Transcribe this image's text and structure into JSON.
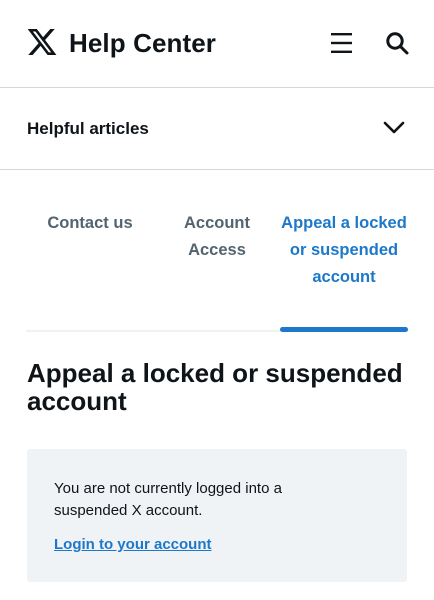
{
  "header": {
    "title": "Help Center",
    "logo_icon": "x-logo-icon",
    "menu_icon": "hamburger-menu-icon",
    "search_icon": "search-icon"
  },
  "accordion": {
    "label": "Helpful articles",
    "icon": "chevron-down-icon"
  },
  "tabs": [
    {
      "label": "Contact us",
      "active": false
    },
    {
      "label": "Account Access",
      "active": false
    },
    {
      "label": "Appeal a locked or suspended account",
      "active": true
    }
  ],
  "main": {
    "title": "Appeal a locked or suspended account",
    "notice": {
      "text": "You are not currently logged into a suspended X account.",
      "link_label": "Login to your account"
    }
  },
  "colors": {
    "accent": "#1d78c9",
    "text": "#0f1419",
    "muted_text": "#536471",
    "divider": "#cfd9de",
    "notice_bg": "#f0f3f6"
  }
}
